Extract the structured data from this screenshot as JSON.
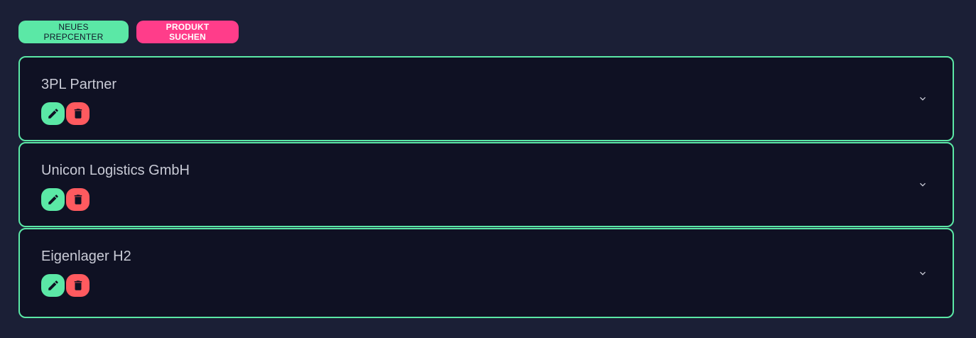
{
  "toolbar": {
    "new_prepcenter_label": "NEUES PREPCENTER",
    "search_product_label": "PRODUKT SUCHEN"
  },
  "prepcenters": [
    {
      "name": "3PL Partner"
    },
    {
      "name": "Unicon Logistics GmbH"
    },
    {
      "name": "Eigenlager H2"
    }
  ],
  "colors": {
    "background": "#1b1f36",
    "card_background": "#0f1123",
    "accent_green": "#5be8a6",
    "accent_pink": "#ff3d8a",
    "delete_red": "#ff5a5f"
  },
  "icons": {
    "edit": "pencil-icon",
    "delete": "trash-icon",
    "expand": "chevron-down-icon"
  }
}
